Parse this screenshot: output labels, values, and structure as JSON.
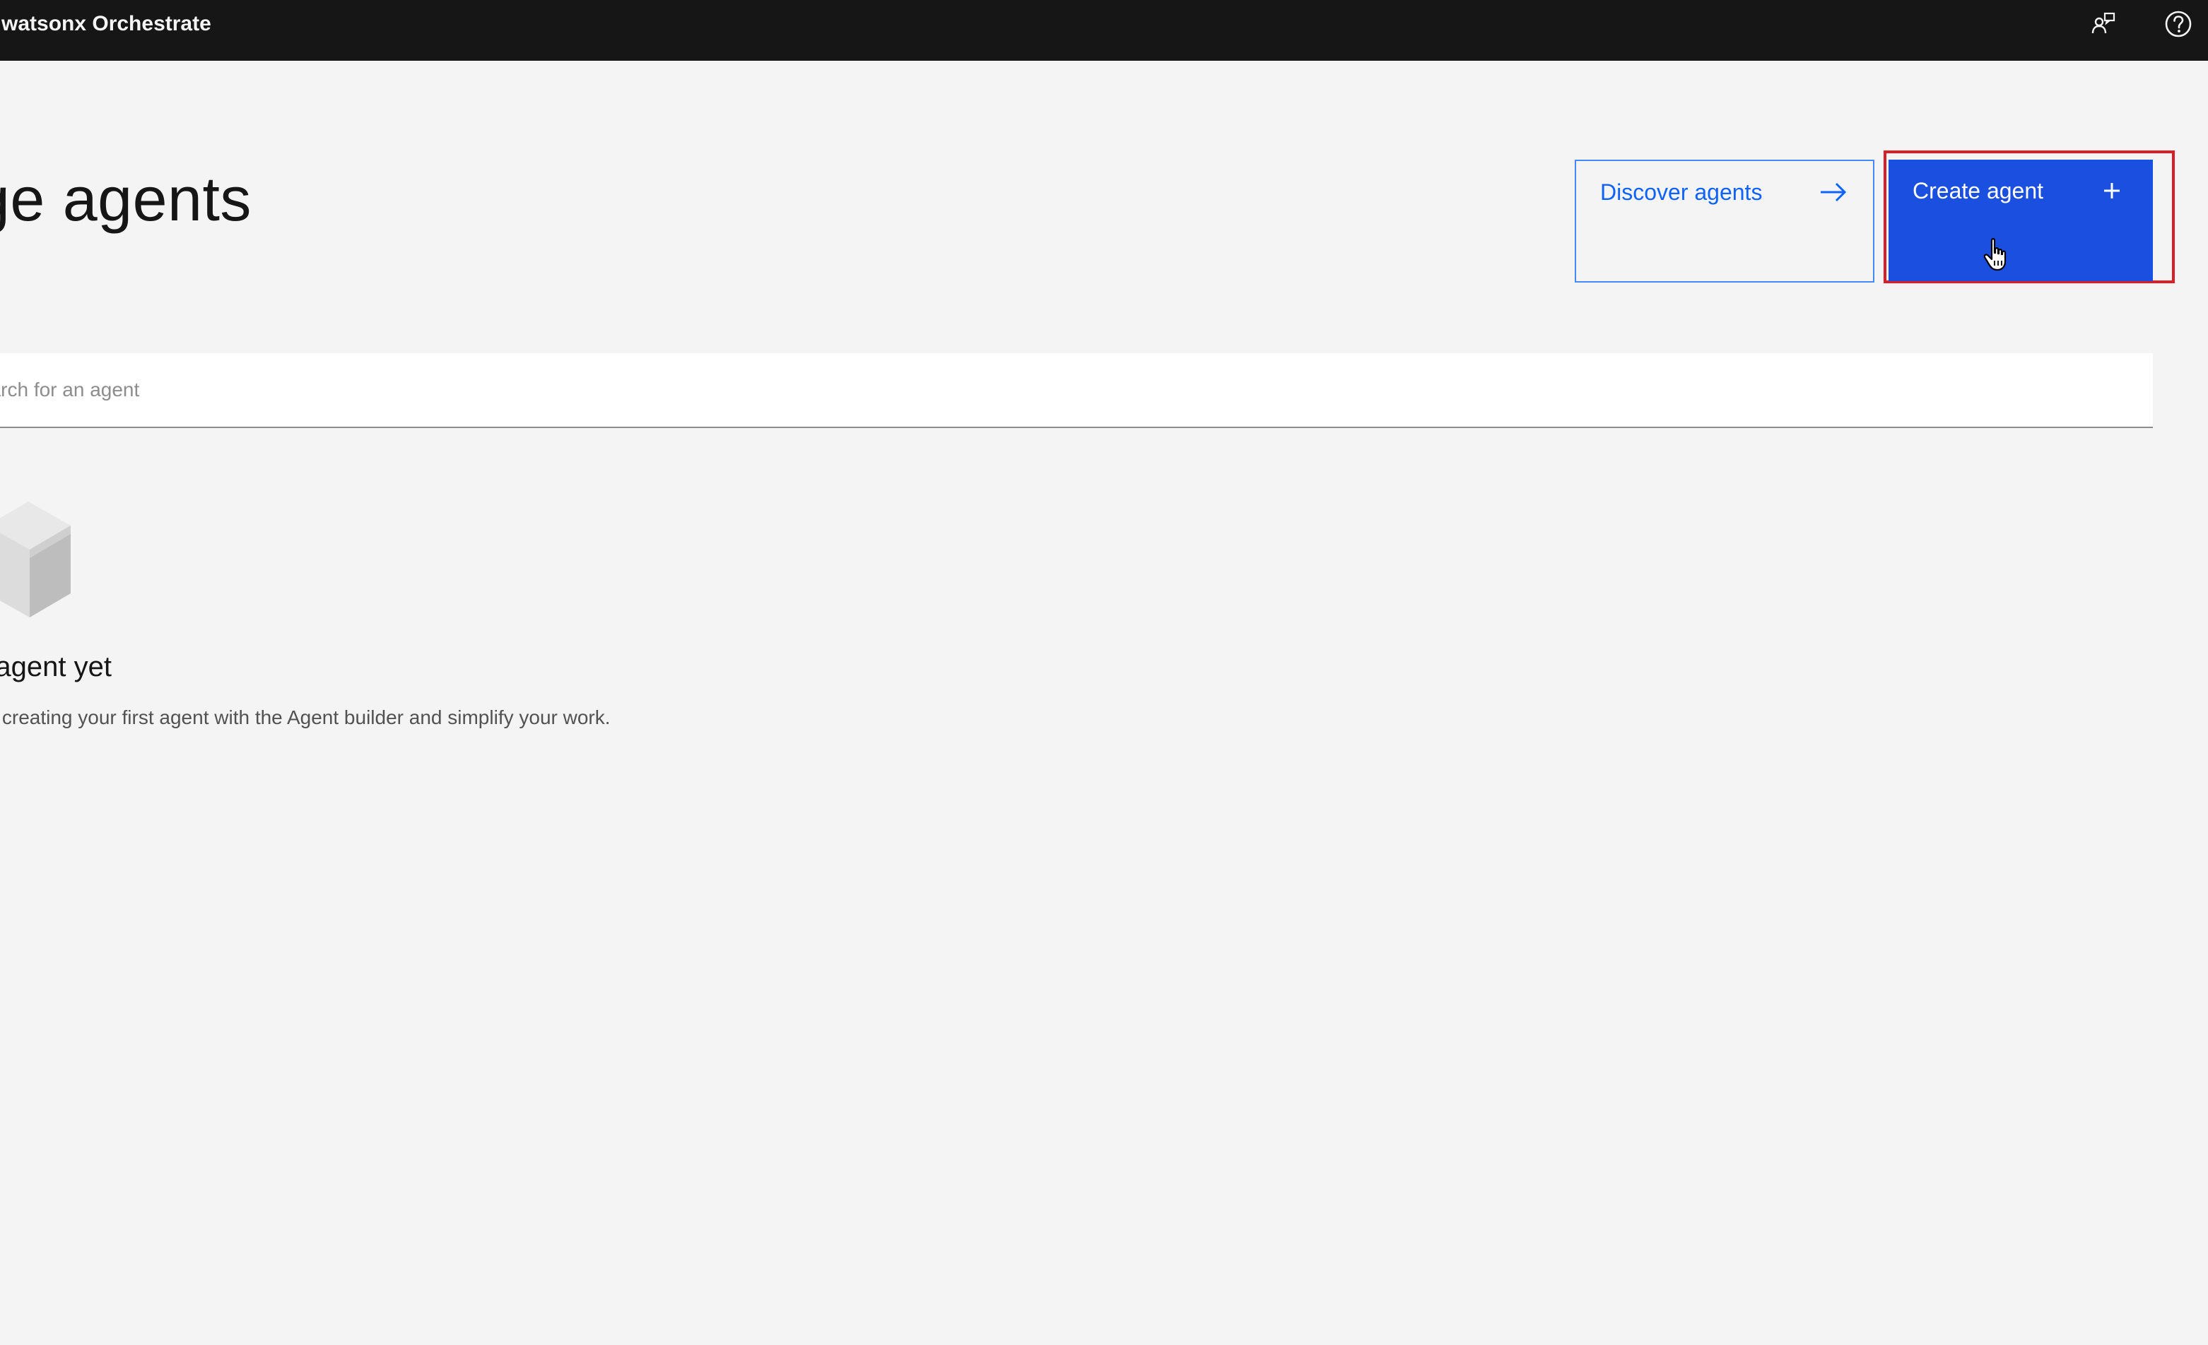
{
  "header": {
    "app_title": "watsonx Orchestrate",
    "user_icon": "user-feedback-icon",
    "help_icon": "help-icon"
  },
  "page": {
    "title": "nage agents"
  },
  "actions": {
    "discover_label": "Discover agents",
    "discover_icon": "arrow-right-icon",
    "create_label": "Create agent",
    "create_icon": "plus-icon"
  },
  "search": {
    "placeholder": "earch for an agent",
    "value": ""
  },
  "empty_state": {
    "illustration_icon": "cube-icon",
    "title": "o agent yet",
    "description": "rt creating your first agent with the Agent builder and simplify your work."
  },
  "colors": {
    "header_bg": "#161616",
    "page_bg": "#f4f4f4",
    "primary": "#1a4fe0",
    "link": "#0f62fe",
    "highlight": "#da1e28"
  }
}
